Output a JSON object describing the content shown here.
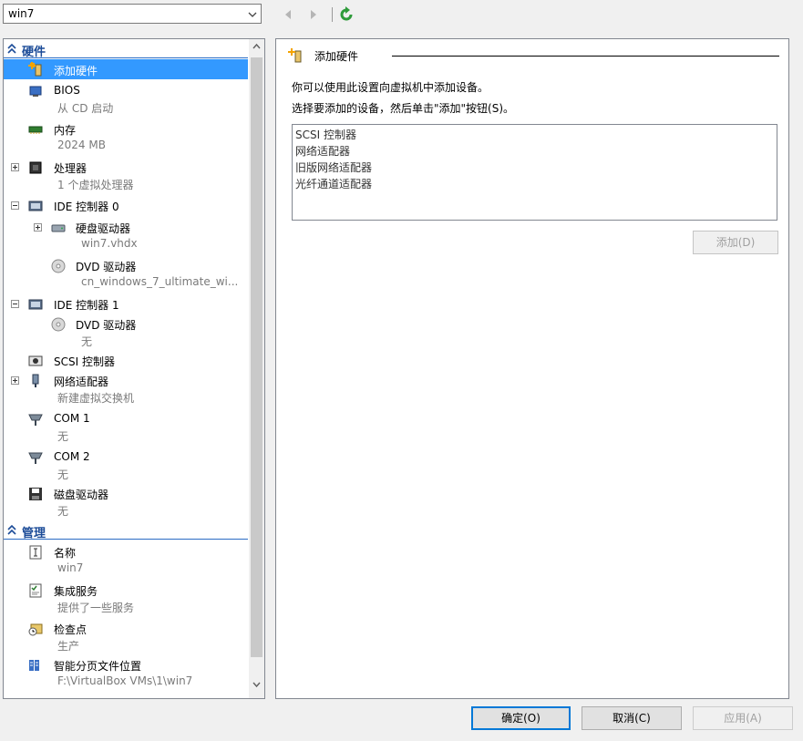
{
  "toolbar": {
    "vm_name": "win7"
  },
  "tree": {
    "hardware_label": "硬件",
    "management_label": "管理",
    "items": [
      {
        "title": "添加硬件",
        "sub": ""
      },
      {
        "title": "BIOS",
        "sub": "从 CD 启动"
      },
      {
        "title": "内存",
        "sub": "2024 MB"
      },
      {
        "title": "处理器",
        "sub": "1 个虚拟处理器"
      },
      {
        "title": "IDE 控制器 0",
        "sub": ""
      },
      {
        "title": "硬盘驱动器",
        "sub": "win7.vhdx"
      },
      {
        "title": "DVD 驱动器",
        "sub": "cn_windows_7_ultimate_wi..."
      },
      {
        "title": "IDE 控制器 1",
        "sub": ""
      },
      {
        "title": "DVD 驱动器",
        "sub": "无"
      },
      {
        "title": "SCSI 控制器",
        "sub": ""
      },
      {
        "title": "网络适配器",
        "sub": "新建虚拟交换机"
      },
      {
        "title": "COM 1",
        "sub": "无"
      },
      {
        "title": "COM 2",
        "sub": "无"
      },
      {
        "title": "磁盘驱动器",
        "sub": "无"
      }
    ],
    "mgmt_items": [
      {
        "title": "名称",
        "sub": "win7"
      },
      {
        "title": "集成服务",
        "sub": "提供了一些服务"
      },
      {
        "title": "检查点",
        "sub": "生产"
      },
      {
        "title": "智能分页文件位置",
        "sub": "F:\\VirtualBox VMs\\1\\win7"
      }
    ]
  },
  "pane": {
    "title": "添加硬件",
    "description_1": "你可以使用此设置向虚拟机中添加设备。",
    "description_2": "选择要添加的设备，然后单击\"添加\"按钮(S)。",
    "devices": [
      "SCSI 控制器",
      "网络适配器",
      "旧版网络适配器",
      "光纤通道适配器"
    ],
    "add_button": "添加(D)"
  },
  "buttons": {
    "ok": "确定(O)",
    "cancel": "取消(C)",
    "apply": "应用(A)"
  },
  "colors": {
    "selection": "#3399ff",
    "section_header": "#1c4c98",
    "default_button_border": "#0078d7"
  }
}
